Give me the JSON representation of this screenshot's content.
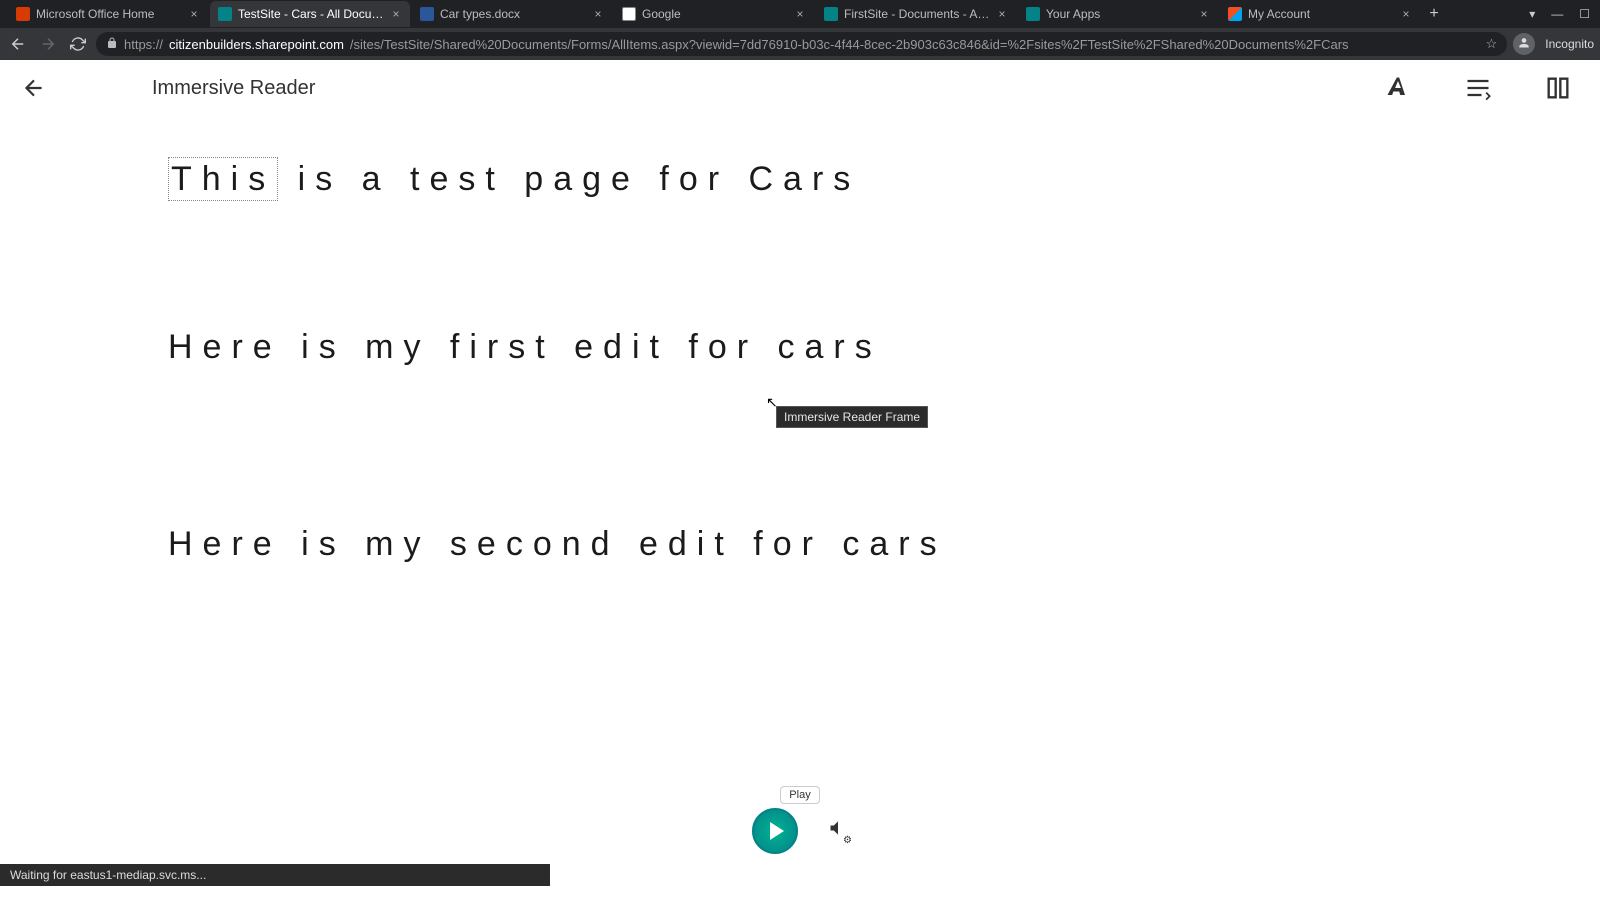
{
  "browser": {
    "tabs": [
      {
        "title": "Microsoft Office Home",
        "favicon": "#d83b01",
        "active": false
      },
      {
        "title": "TestSite - Cars - All Documents",
        "favicon": "#038387",
        "active": true
      },
      {
        "title": "Car types.docx",
        "favicon": "#2b579a",
        "active": false
      },
      {
        "title": "Google",
        "favicon": "#ffffff",
        "active": false
      },
      {
        "title": "FirstSite - Documents - All Docu…",
        "favicon": "#038387",
        "active": false
      },
      {
        "title": "Your Apps",
        "favicon": "#038387",
        "active": false
      },
      {
        "title": "My Account",
        "favicon": "#00a4ef",
        "active": false
      }
    ],
    "url_domain": "citizenbuilders.sharepoint.com",
    "url_path": "/sites/TestSite/Shared%20Documents/Forms/AllItems.aspx?viewid=7dd76910-b03c-4f44-8cec-2b903c63c846&id=%2Fsites%2FTestSite%2FShared%20Documents%2FCars",
    "url_prefix": "https://",
    "incognito_label": "Incognito",
    "status_text": "Waiting for eastus1-mediap.svc.ms..."
  },
  "reader": {
    "title": "Immersive Reader",
    "paragraphs": [
      {
        "highlight": "This",
        "rest": " is a test page for Cars"
      },
      {
        "text": "Here is my first edit for cars"
      },
      {
        "text": "Here is my second edit for cars"
      }
    ],
    "tooltip": "Immersive Reader Frame",
    "play_tooltip": "Play"
  }
}
